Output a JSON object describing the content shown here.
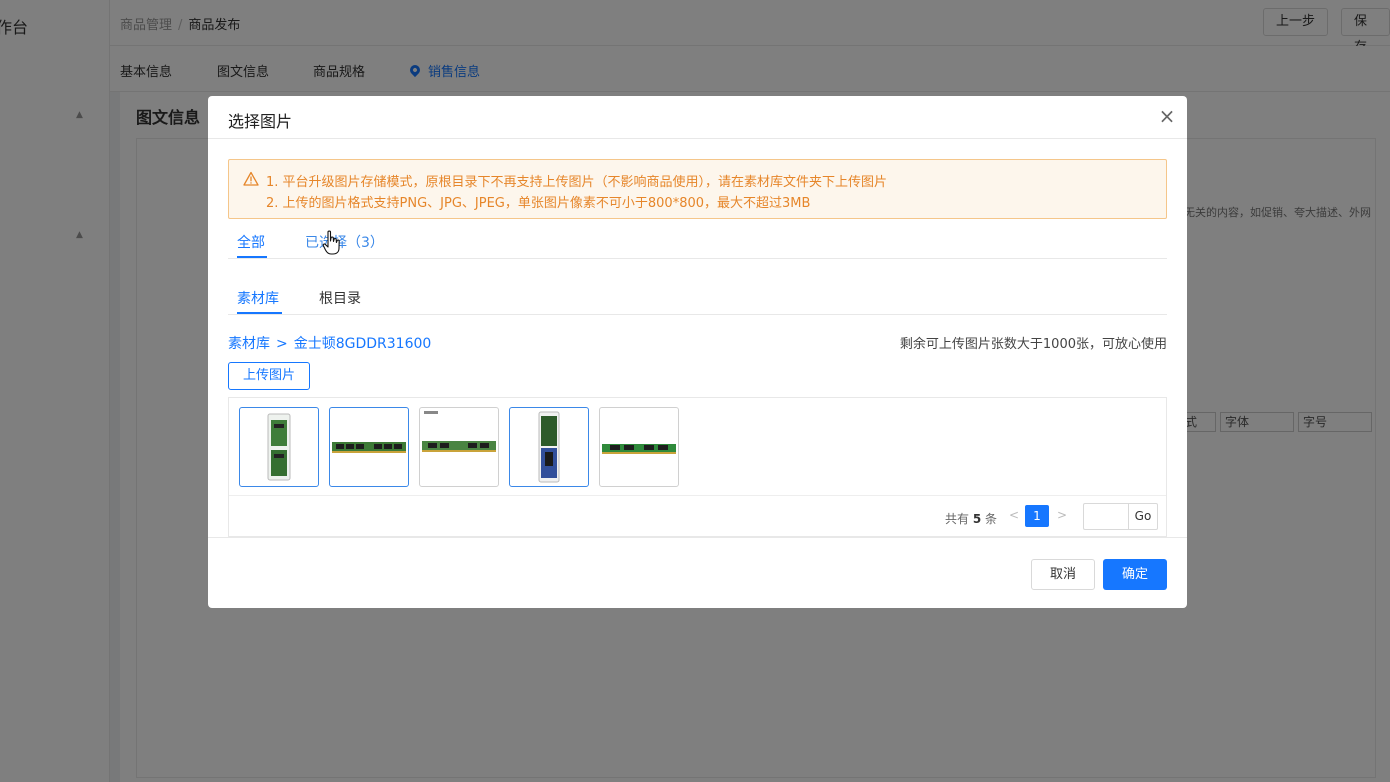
{
  "background": {
    "sidebar_logo": "作台",
    "breadcrumb": {
      "parent": "商品管理",
      "separator": "/",
      "current": "商品发布"
    },
    "top_buttons": [
      "上一步",
      "保存草"
    ],
    "tabs": [
      "基本信息",
      "图文信息",
      "商品规格",
      "销售信息"
    ],
    "section_title": "图文信息",
    "side_text": "无关的内容，如促销、夸大描述、外网",
    "editor_selects": [
      "式",
      "字体",
      "字号"
    ]
  },
  "modal": {
    "title": "选择图片",
    "alert": {
      "line1": "1. 平台升级图片存储模式，原根目录下不再支持上传图片（不影响商品使用），请在素材库文件夹下上传图片",
      "line2": "2. 上传的图片格式支持PNG、JPG、JPEG，单张图片像素不可小于800*800，最大不超过3MB"
    },
    "filter_tabs": [
      {
        "label": "全部"
      },
      {
        "label": "已选择（3）"
      }
    ],
    "source_tabs": [
      {
        "label": "素材库"
      },
      {
        "label": "根目录"
      }
    ],
    "path": {
      "root": "素材库",
      "separator": ">",
      "folder": "金士顿8GDDR31600"
    },
    "remaining": "剩余可上传图片张数大于1000张，可放心使用",
    "upload_label": "上传图片",
    "thumbnails": [
      {
        "name": "ram-package",
        "selected": true
      },
      {
        "name": "ram-stick",
        "selected": true
      },
      {
        "name": "ram-stick-branded",
        "selected": false
      },
      {
        "name": "ram-package-blue",
        "selected": true
      },
      {
        "name": "ram-stick-green",
        "selected": false
      }
    ],
    "pager": {
      "total_prefix": "共有",
      "total": "5",
      "total_suffix": "条",
      "prev": "<",
      "page": "1",
      "next": ">",
      "go": "Go"
    },
    "footer": {
      "cancel": "取消",
      "ok": "确定"
    }
  },
  "colors": {
    "primary": "#1677ff",
    "warning_text": "#e6862a",
    "warning_bg": "#fdf6ec",
    "warning_border": "#f5c68a"
  }
}
